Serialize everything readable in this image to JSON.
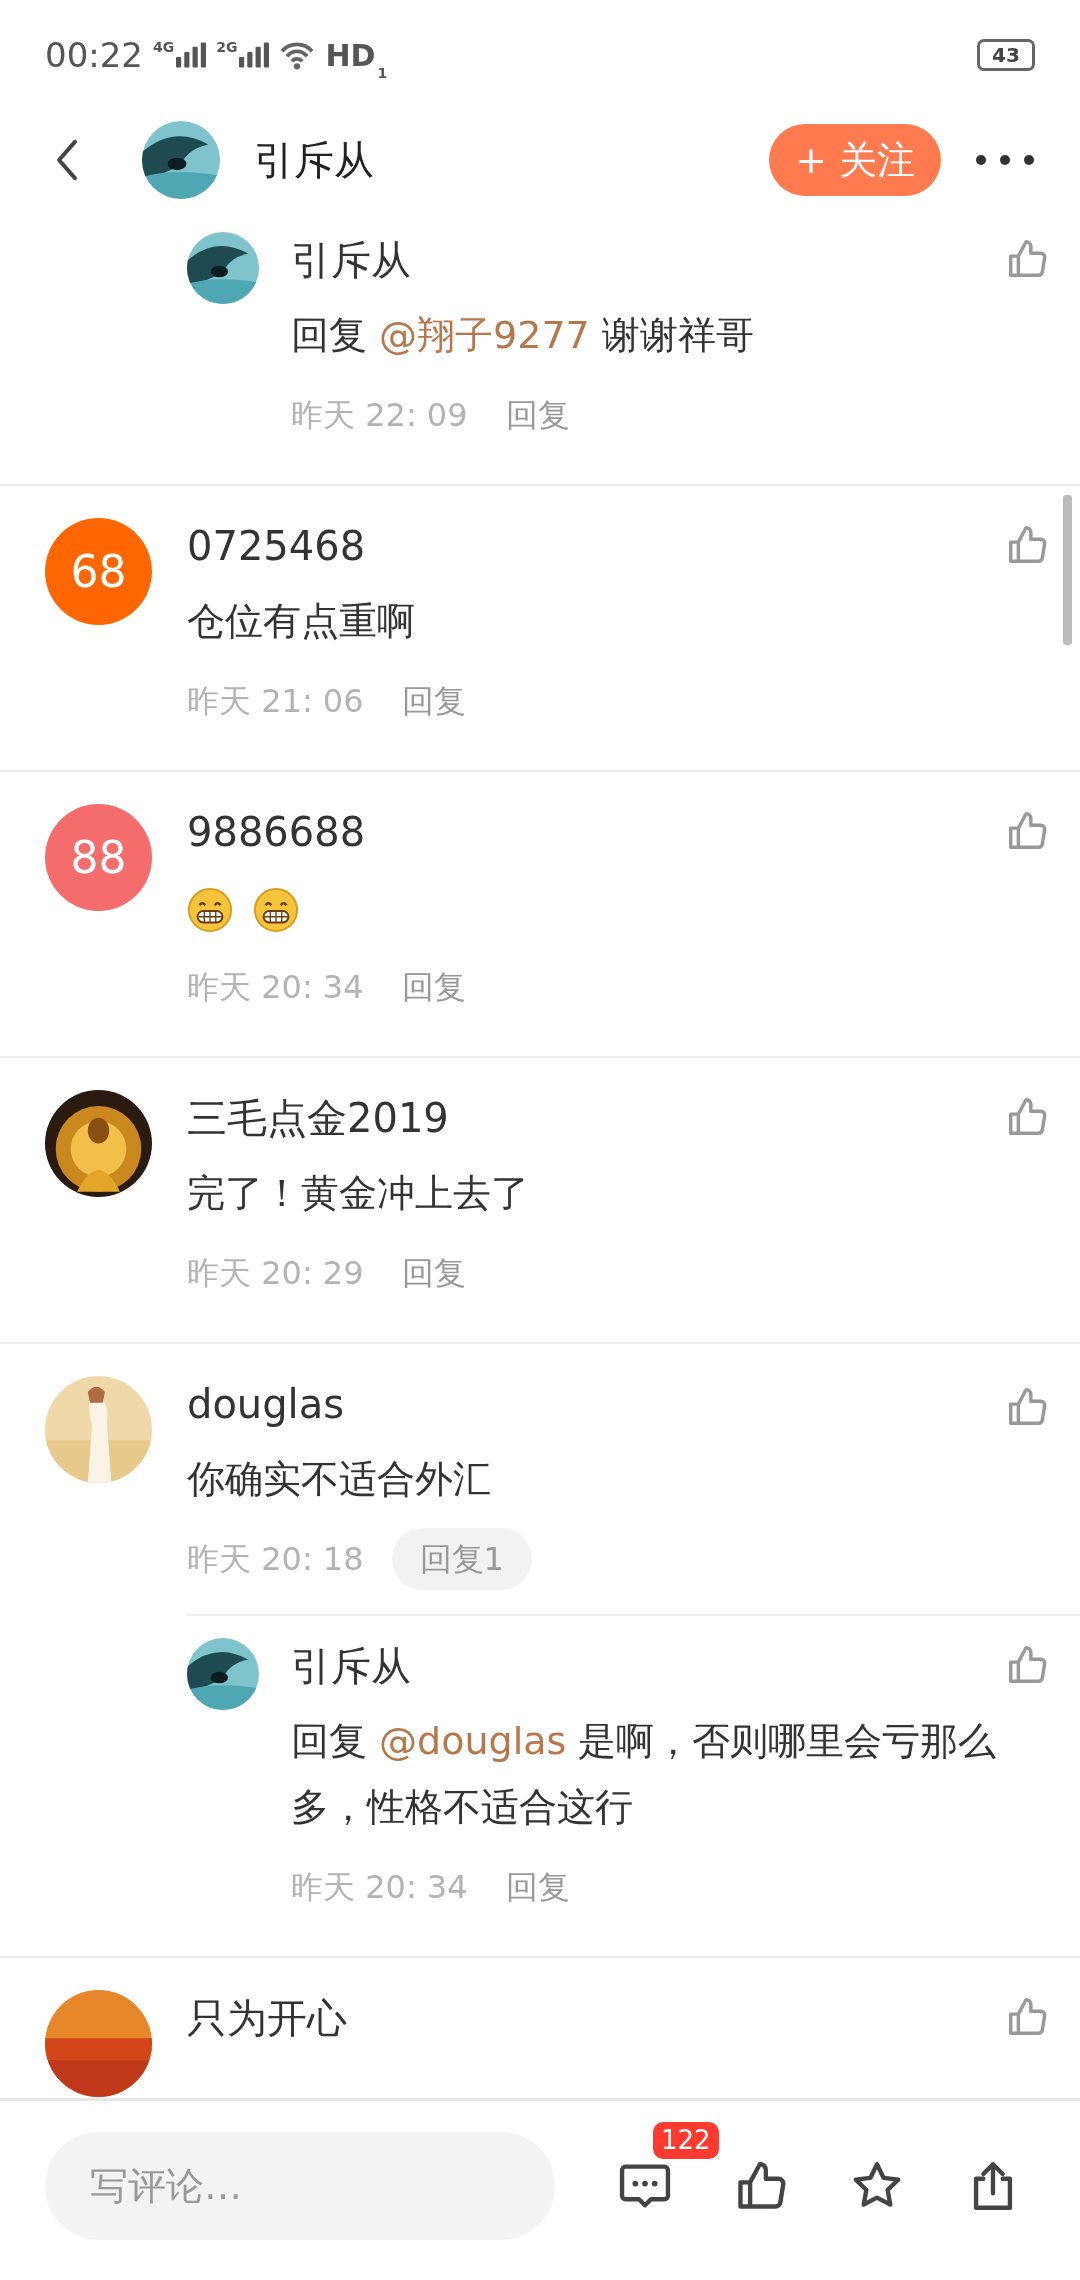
{
  "status_bar": {
    "time": "00:22",
    "network_1": "4G",
    "network_2": "2G",
    "hd": "HD",
    "sim": "1",
    "battery": "43"
  },
  "header": {
    "name": "引斥从",
    "follow_button": "+ 关注"
  },
  "comments": [
    {
      "kind": "reply",
      "avatar": {
        "kind": "picture"
      },
      "name": "引斥从",
      "content": [
        {
          "kind": "text",
          "text": "回复 "
        },
        {
          "kind": "mention",
          "text": "@翔子9277"
        },
        {
          "kind": "text",
          "text": " 谢谢祥哥"
        }
      ],
      "time": "昨天 22: 09",
      "reply": {
        "label": "回复",
        "pill": false
      }
    },
    {
      "kind": "comment",
      "avatar": {
        "kind": "number",
        "text": "68",
        "color": "#ff6600"
      },
      "name": "0725468",
      "content": [
        {
          "kind": "text",
          "text": "仓位有点重啊"
        }
      ],
      "time": "昨天 21: 06",
      "reply": {
        "label": "回复",
        "pill": false
      }
    },
    {
      "kind": "comment",
      "avatar": {
        "kind": "number",
        "text": "88",
        "color": "#f46c6c"
      },
      "name": "9886688",
      "content": [
        {
          "kind": "emoji"
        },
        {
          "kind": "emoji"
        }
      ],
      "time": "昨天 20: 34",
      "reply": {
        "label": "回复",
        "pill": false
      }
    },
    {
      "kind": "comment",
      "avatar": {
        "kind": "picture"
      },
      "name": "三毛点金2019",
      "content": [
        {
          "kind": "text",
          "text": "完了！黄金冲上去了"
        }
      ],
      "time": "昨天 20: 29",
      "reply": {
        "label": "回复",
        "pill": false
      }
    },
    {
      "kind": "comment",
      "avatar": {
        "kind": "picture"
      },
      "name": "douglas",
      "content": [
        {
          "kind": "text",
          "text": "你确实不适合外汇"
        }
      ],
      "time": "昨天 20: 18",
      "reply": {
        "label": "回复1",
        "pill": true
      },
      "replies": [
        {
          "kind": "reply",
          "avatar": {
            "kind": "picture"
          },
          "name": "引斥从",
          "content": [
            {
              "kind": "text",
              "text": "回复 "
            },
            {
              "kind": "mention",
              "text": "@douglas"
            },
            {
              "kind": "text",
              "text": " 是啊，否则哪里会亏那么多，性格不适合这行"
            }
          ],
          "time": "昨天 20: 34",
          "reply": {
            "label": "回复",
            "pill": false
          }
        }
      ]
    },
    {
      "kind": "comment",
      "avatar": {
        "kind": "picture"
      },
      "name": "只为开心"
    }
  ],
  "bottom_bar": {
    "placeholder": "写评论…",
    "comment_count": "122"
  }
}
